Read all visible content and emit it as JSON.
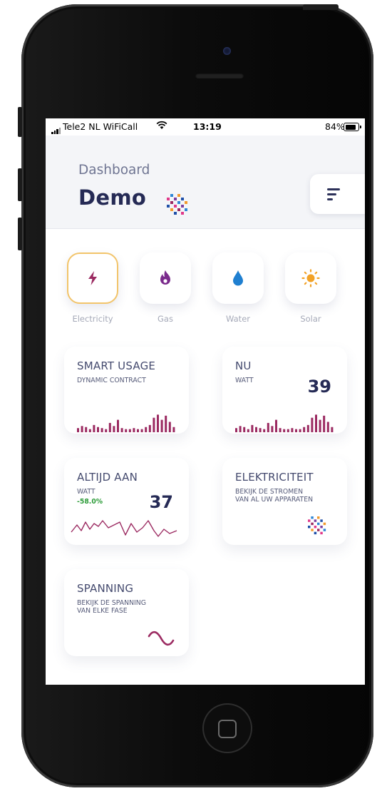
{
  "status": {
    "carrier": "Tele2 NL WiFiCall",
    "time": "13:19",
    "battery": "84%"
  },
  "header": {
    "subtitle": "Dashboard",
    "title": "Demo"
  },
  "categories": [
    {
      "label": "Electricity",
      "icon": "lightning-icon",
      "color": "#9b2a61",
      "active": true
    },
    {
      "label": "Gas",
      "icon": "flame-icon",
      "color": "#7a2a8c",
      "active": false
    },
    {
      "label": "Water",
      "icon": "water-drop-icon",
      "color": "#1f7fd0",
      "active": false
    },
    {
      "label": "Solar",
      "icon": "sun-icon",
      "color": "#f2a227",
      "active": false
    }
  ],
  "cards": {
    "smart_usage": {
      "title": "SMART USAGE",
      "subtitle": "DYNAMIC CONTRACT"
    },
    "nu": {
      "title": "NU",
      "subtitle": "WATT",
      "value": "39"
    },
    "altijd_aan": {
      "title": "ALTIJD AAN",
      "subtitle": "WATT",
      "change": "-58.0%",
      "value": "37"
    },
    "elektriciteit": {
      "title": "ELEKTRICITEIT",
      "line1": "BEKIJK DE STROMEN",
      "line2": "VAN AL UW APPARATEN"
    },
    "spanning": {
      "title": "SPANNING",
      "line1": "BEKIJK DE SPANNING",
      "line2": "VAN ELKE FASE"
    }
  },
  "colors": {
    "accent": "#9b2a61",
    "title_navy": "#252a55",
    "active_border": "#f2c46a",
    "positive_green": "#2e9c3a"
  }
}
